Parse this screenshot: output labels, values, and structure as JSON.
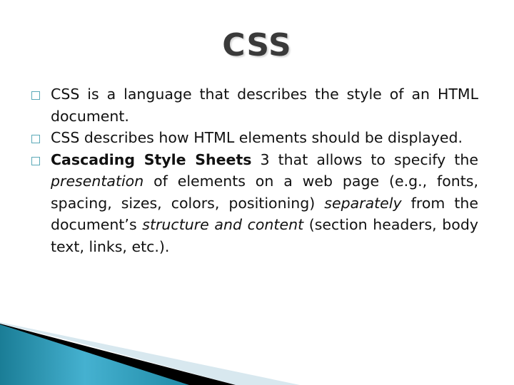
{
  "slide": {
    "title": "CSS",
    "bullets": [
      {
        "text": "CSS is a language that describes the style of an HTML document."
      },
      {
        "text": "CSS describes how HTML elements should be displayed."
      },
      {
        "segments": {
          "bold": "Cascading Style Sheets",
          "t1": " 3  that allows to specify the ",
          "i1": "presentation",
          "t2": " of elements on a web page (e.g., fonts, spacing, sizes, colors, positioning) ",
          "i2": "separately",
          "t3": " from the document’s ",
          "i3": "structure and content",
          "t4": " (section headers, body text, links, etc.)."
        }
      }
    ],
    "bullet_icon": "square-box-bullet",
    "colors": {
      "title": "#3a3a3a",
      "text": "#111111",
      "bullet_border": "#5ba9b8",
      "swoosh_teal": "#2a8ea8",
      "swoosh_black": "#000000",
      "swoosh_light": "#d8e8ef"
    }
  }
}
